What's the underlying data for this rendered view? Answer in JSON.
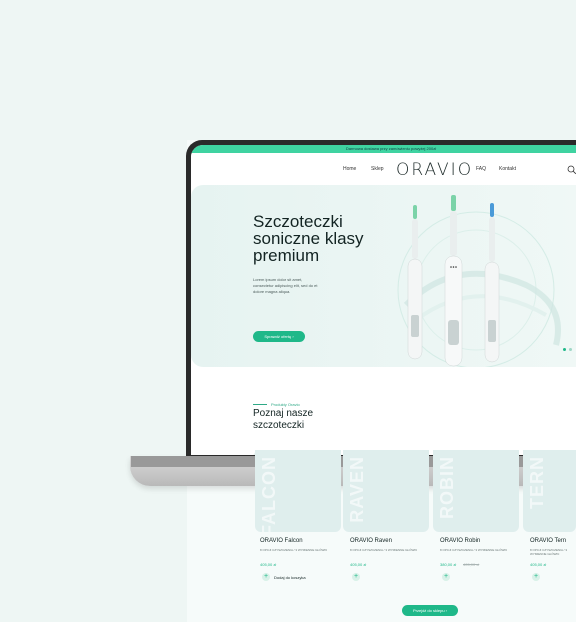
{
  "announcement": "Darmowa dostawa przy zamówieniu powyżej 200zł",
  "nav": {
    "home": "Home",
    "shop": "Sklep",
    "faq": "FAQ",
    "contact": "Kontakt"
  },
  "logo": "ORAVIO",
  "hero": {
    "title": "Szczoteczki soniczne klasy premium",
    "text": "Lorem ipsum dolor sit amet, consectetur adipiscing elit, sed do et dolore magna aliqua.",
    "cta": "Sprawdź ofertę"
  },
  "products_section": {
    "kicker": "Produkty Oravio",
    "title": "Poznaj nasze szczoteczki"
  },
  "products": [
    {
      "vertical": "FALCON",
      "name": "ORAVIO Falcon",
      "options": "8 OPCJI CZYSZCZENIA / 3 WYMIENNE GŁÓWKI",
      "price": "405,00 zł",
      "old_price": "",
      "add_label": "Dodaj do koszyka"
    },
    {
      "vertical": "RAVEN",
      "name": "ORAVIO Raven",
      "options": "8 OPCJI CZYSZCZENIA / 3 WYMIENNE GŁÓWKI",
      "price": "405,00 zł",
      "old_price": ""
    },
    {
      "vertical": "ROBIN",
      "name": "ORAVIO Robin",
      "options": "8 OPCJI CZYSZCZENIA / 3 WYMIENNE GŁÓWKI",
      "price": "380,00 zł",
      "old_price": "405,00 zł"
    },
    {
      "vertical": "TERN",
      "name": "ORAVIO Tern",
      "options": "8 OPCJI CZYSZCZENIA / 3 WYMIENNE GŁÓWKI",
      "price": "405,00 zł",
      "old_price": ""
    }
  ],
  "shop_button": "Przejdź do sklepu",
  "colors": {
    "accent": "#1fb889",
    "announcement": "#3fd3a1",
    "hero_bg": "#e6f3f1",
    "badge_new": "#1fb889",
    "badge_sale": "#e0457b"
  },
  "icons": {
    "search": "search-icon",
    "arrow": "arrow-right-icon",
    "plus": "plus-icon"
  }
}
